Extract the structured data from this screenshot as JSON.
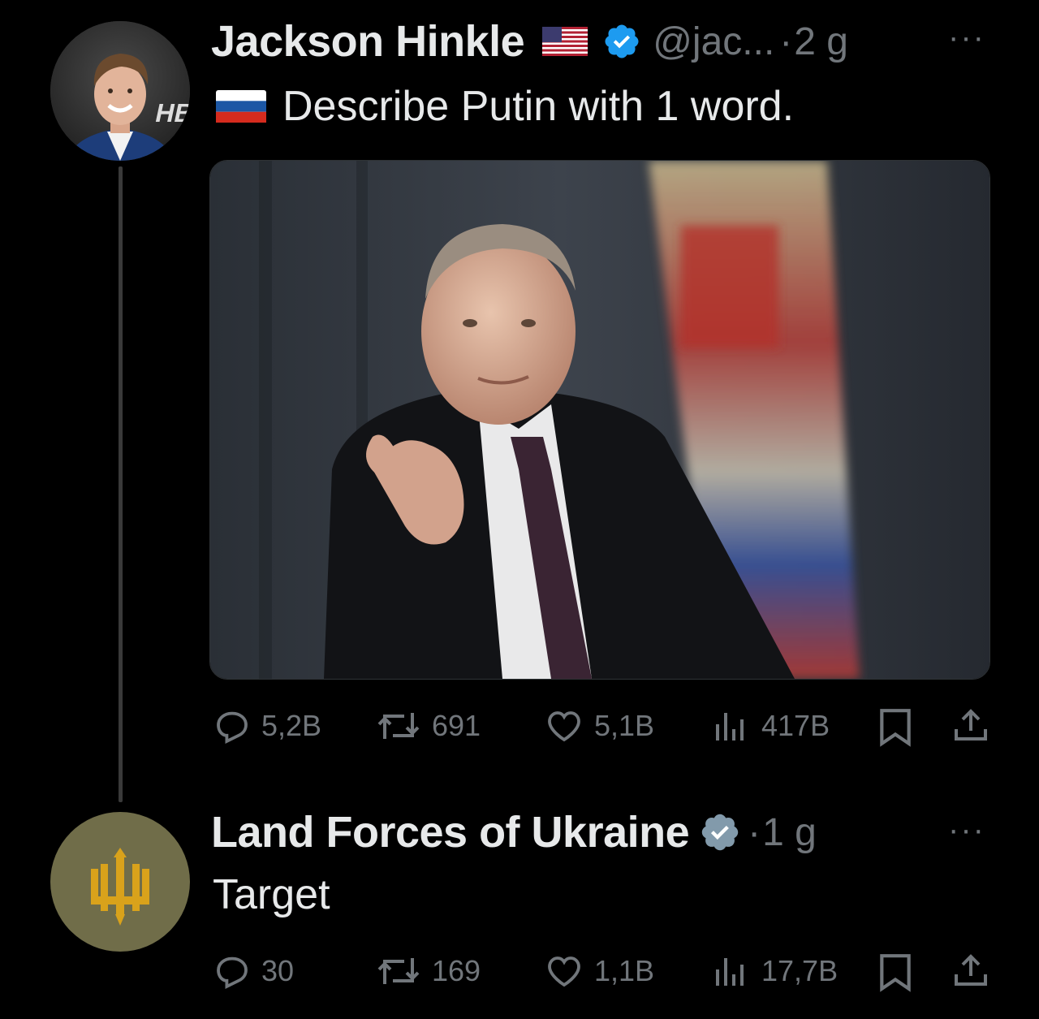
{
  "tweet": {
    "author_name": "Jackson Hinkle",
    "handle": "@jac...",
    "time": "2 g",
    "text": "Describe Putin with 1 word.",
    "avatar_logo_text": "HB",
    "stats": {
      "replies": "5,2B",
      "reposts": "691",
      "likes": "5,1B",
      "views": "417B"
    }
  },
  "reply": {
    "author_name": "Land Forces of Ukraine",
    "time": "1 g",
    "text": "Target",
    "stats": {
      "replies": "30",
      "reposts": "169",
      "likes": "1,1B",
      "views": "17,7B"
    }
  },
  "ui": {
    "separator": "·",
    "more": "···"
  },
  "colors": {
    "background": "#000000",
    "text": "#e7e9ea",
    "muted": "#71767b",
    "verified_blue": "#1d9bf0",
    "verified_gray": "#829aab",
    "reply_avatar_bg": "#706d49",
    "trident_gold": "#d9a21b"
  }
}
